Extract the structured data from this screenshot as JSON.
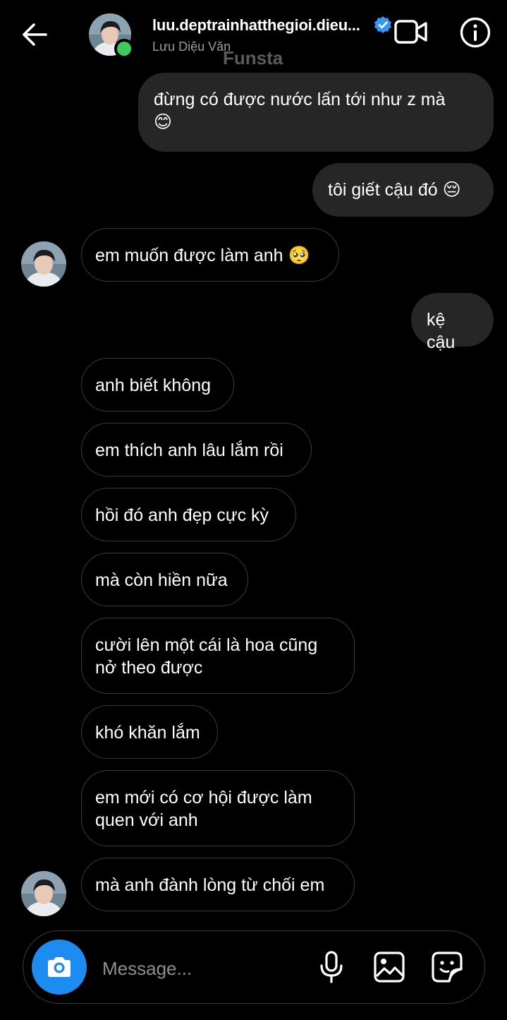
{
  "header": {
    "username": "luu.deptrainhatthegioi.dieu...",
    "display_name": "Lưu Diệu Văn",
    "watermark": "Funsta"
  },
  "messages": [
    {
      "side": "out",
      "text": "đừng có được nước lấn tới như z mà",
      "emoji": "😊"
    },
    {
      "side": "out",
      "text": "tôi giết cậu đó",
      "emoji": "😔"
    },
    {
      "side": "in",
      "text": "em muốn được làm anh",
      "emoji": "🥺",
      "avatar": true
    },
    {
      "side": "out",
      "text": "kệ cậu"
    },
    {
      "side": "in",
      "text": "anh biết không"
    },
    {
      "side": "in",
      "text": "em thích anh lâu lắm rồi"
    },
    {
      "side": "in",
      "text": "hồi đó anh đẹp cực kỳ"
    },
    {
      "side": "in",
      "text": "mà còn hiền nữa"
    },
    {
      "side": "in",
      "text": "cười lên một cái là hoa cũng nở theo được"
    },
    {
      "side": "in",
      "text": "khó khăn lắm"
    },
    {
      "side": "in",
      "text": "em mới có cơ hội được làm quen với anh"
    },
    {
      "side": "in",
      "text": "mà anh đành lòng từ chối em",
      "avatar": true
    }
  ],
  "composer": {
    "placeholder": "Message..."
  },
  "icons": {
    "back": "arrow-left-icon",
    "video": "video-camera-icon",
    "info": "info-icon",
    "verified": "verified-badge-icon",
    "camera": "camera-icon",
    "mic": "microphone-icon",
    "gallery": "image-icon",
    "sticker": "sticker-icon"
  },
  "colors": {
    "background": "#000000",
    "outgoing_bubble": "#262626",
    "incoming_border": "#3a3a3a",
    "camera_button": "#1d8cf0",
    "verified": "#3797f0",
    "online": "#3ecb5c",
    "secondary_text": "#9b9b9b"
  }
}
